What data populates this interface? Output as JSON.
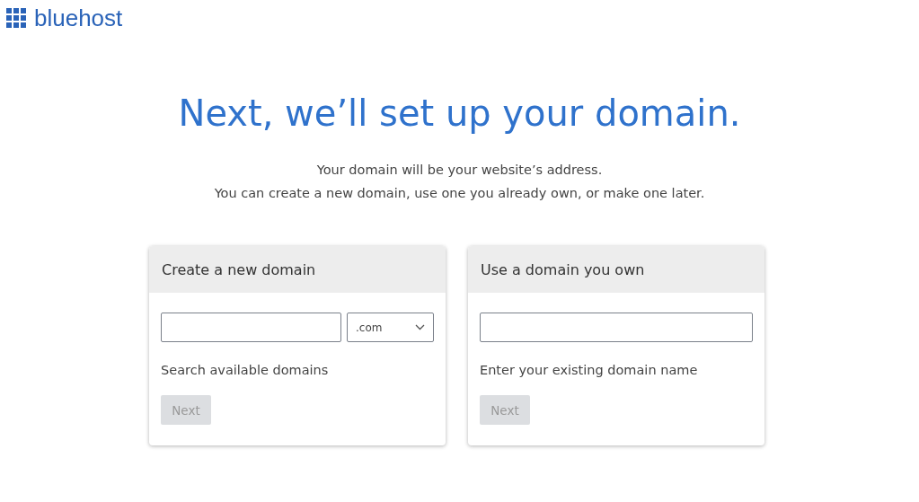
{
  "logo": {
    "text": "bluehost"
  },
  "heading": "Next, we’ll set up your domain.",
  "intro": [
    "Your domain will be your website’s address.",
    "You can create a new domain, use one you already own, or make one later."
  ],
  "cards": [
    {
      "kind": "create",
      "title": "Create a new domain",
      "tld": ".com",
      "hint": "Search available domains",
      "button": {
        "label": "Next",
        "disabled": true
      }
    },
    {
      "kind": "existing",
      "title": "Use a domain you own",
      "hint": "Enter your existing domain name",
      "button": {
        "label": "Next",
        "disabled": true
      }
    }
  ]
}
